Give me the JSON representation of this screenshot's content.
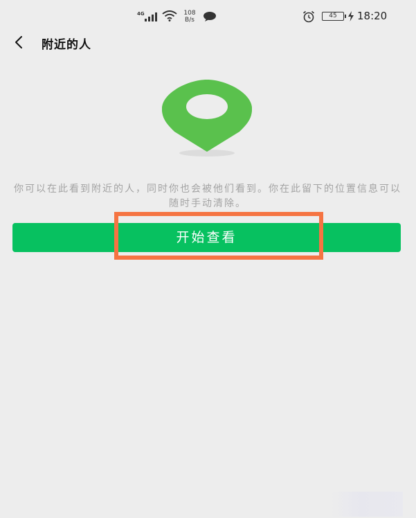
{
  "status_bar": {
    "network": "4G",
    "speed_value": "108",
    "speed_unit": "B/s",
    "battery": "45",
    "time": "18:20"
  },
  "nav": {
    "title": "附近的人"
  },
  "main": {
    "description": "你可以在此看到附近的人，同时你也会被他们看到。你在此留下的位置信息可以随时手动清除。",
    "start_button_label": "开始查看"
  },
  "colors": {
    "background": "#ededed",
    "pin_green": "#5ac14d",
    "button_green": "#07c160",
    "highlight_orange": "#f57442",
    "description_gray": "#a3a3a3"
  },
  "icons": {
    "back": "chevron-left-icon",
    "pin": "location-pin-icon",
    "signal": "signal-icon",
    "wifi": "wifi-icon",
    "message": "message-bubble-icon",
    "alarm": "alarm-clock-icon",
    "battery": "battery-icon",
    "charging": "charging-bolt-icon"
  }
}
